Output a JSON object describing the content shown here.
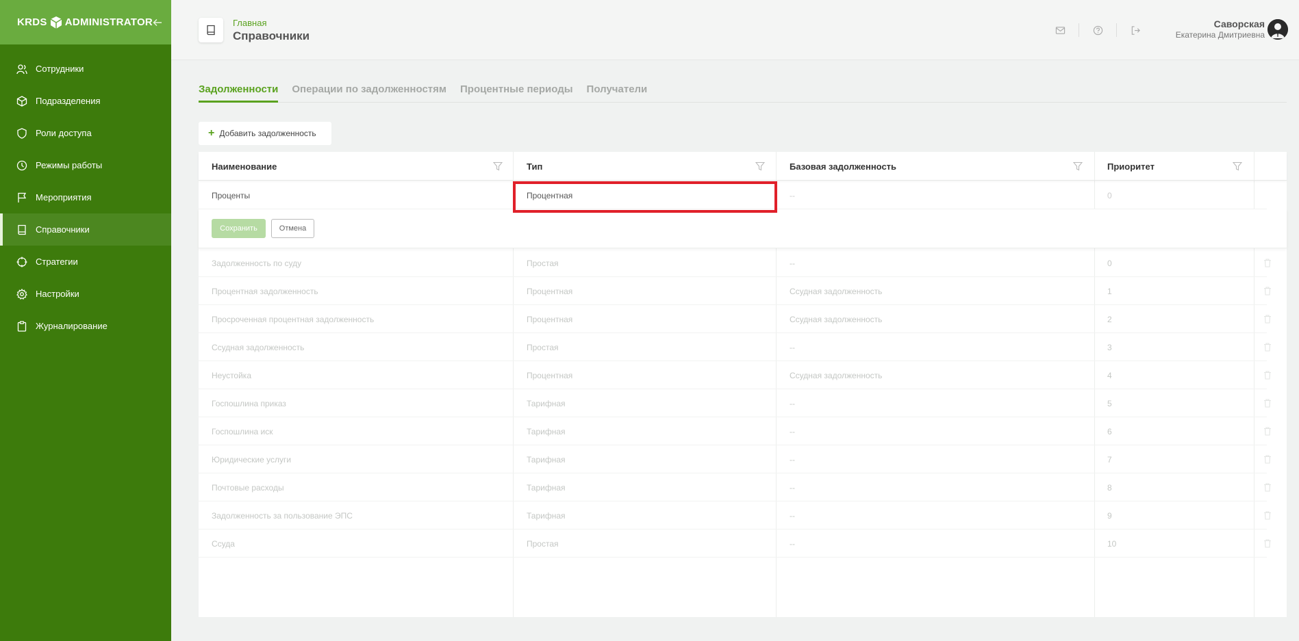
{
  "sidebar": {
    "logo_left": "KRDS",
    "logo_right": "ADMINISTRATOR",
    "items": [
      {
        "label": "Сотрудники",
        "icon": "users-icon"
      },
      {
        "label": "Подразделения",
        "icon": "cube-icon"
      },
      {
        "label": "Роли доступа",
        "icon": "shield-icon"
      },
      {
        "label": "Режимы работы",
        "icon": "clock-icon"
      },
      {
        "label": "Мероприятия",
        "icon": "flag-icon"
      },
      {
        "label": "Справочники",
        "icon": "book-icon",
        "active": true
      },
      {
        "label": "Стратегии",
        "icon": "crosshair-icon"
      },
      {
        "label": "Настройки",
        "icon": "gear-icon"
      },
      {
        "label": "Журналирование",
        "icon": "clipboard-icon"
      }
    ]
  },
  "header": {
    "breadcrumb_home": "Главная",
    "title": "Справочники",
    "user_last_name": "Саворская",
    "user_first_names": "Екатерина Дмитриевна",
    "icons": [
      "mail-icon",
      "help-icon",
      "logout-icon"
    ]
  },
  "tabs": [
    {
      "label": "Задолженности",
      "active": true
    },
    {
      "label": "Операции по задолженностям"
    },
    {
      "label": "Процентные периоды"
    },
    {
      "label": "Получатели"
    }
  ],
  "add_button_label": "Добавить задолженность",
  "table": {
    "columns": [
      "Наименование",
      "Тип",
      "Базовая задолженность",
      "Приоритет"
    ],
    "edit_row": {
      "name": "Проценты",
      "type": "Процентная",
      "base": "--",
      "priority": "0"
    },
    "save_label": "Сохранить",
    "cancel_label": "Отмена",
    "rows": [
      {
        "name": "Задолженность по суду",
        "type": "Простая",
        "base": "--",
        "priority": "0"
      },
      {
        "name": "Процентная задолженность",
        "type": "Процентная",
        "base": "Ссудная задолженность",
        "priority": "1"
      },
      {
        "name": "Просроченная процентная задолженность",
        "type": "Процентная",
        "base": "Ссудная задолженность",
        "priority": "2"
      },
      {
        "name": "Ссудная задолженность",
        "type": "Простая",
        "base": "--",
        "priority": "3"
      },
      {
        "name": "Неустойка",
        "type": "Процентная",
        "base": "Ссудная задолженность",
        "priority": "4"
      },
      {
        "name": "Госпошлина приказ",
        "type": "Тарифная",
        "base": "--",
        "priority": "5"
      },
      {
        "name": "Госпошлина иск",
        "type": "Тарифная",
        "base": "--",
        "priority": "6"
      },
      {
        "name": "Юридические услуги",
        "type": "Тарифная",
        "base": "--",
        "priority": "7"
      },
      {
        "name": "Почтовые расходы",
        "type": "Тарифная",
        "base": "--",
        "priority": "8"
      },
      {
        "name": "Задолженность за пользование ЭПС",
        "type": "Тарифная",
        "base": "--",
        "priority": "9"
      },
      {
        "name": "Ссуда",
        "type": "Простая",
        "base": "--",
        "priority": "10"
      }
    ]
  },
  "colors": {
    "sidebar": "#3d7b0c",
    "sidebar_header": "#6aac3f",
    "accent": "#5aa21f",
    "highlight": "#e0202a"
  }
}
